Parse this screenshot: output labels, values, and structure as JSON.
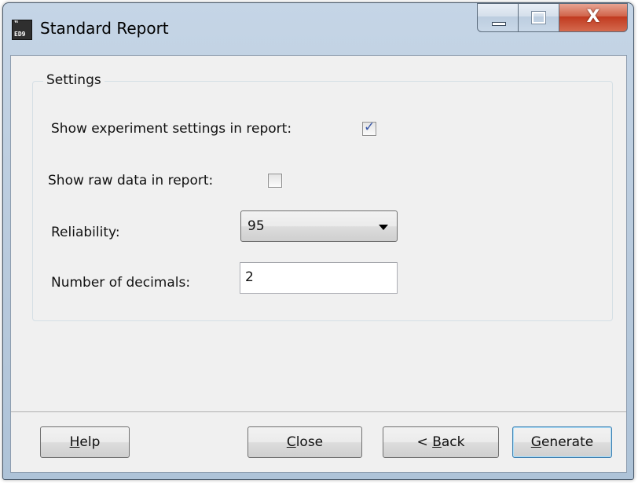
{
  "window": {
    "app_icon_text": "ED9",
    "title": "Standard Report",
    "caption": {
      "minimize_icon": "minimize-icon",
      "maximize_icon": "maximize-icon",
      "close_glyph": "X"
    }
  },
  "settings": {
    "group_label": "Settings",
    "show_experiment_settings": {
      "label": "Show experiment settings in report:",
      "checked": true
    },
    "show_raw_data": {
      "label": "Show raw data in report:",
      "checked": false
    },
    "reliability": {
      "label": "Reliability:",
      "value": "95"
    },
    "decimals": {
      "label": "Number of decimals:",
      "value": "2"
    }
  },
  "buttons": {
    "help": {
      "mnemonic": "H",
      "rest": "elp"
    },
    "close": {
      "mnemonic": "C",
      "rest": "lose"
    },
    "back": {
      "prefix": "< ",
      "mnemonic": "B",
      "rest": "ack"
    },
    "generate": {
      "mnemonic": "G",
      "rest": "enerate"
    }
  }
}
